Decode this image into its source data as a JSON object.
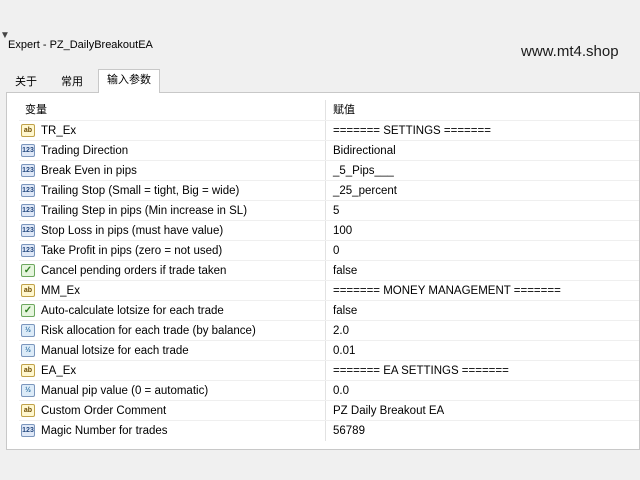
{
  "window": {
    "title": "Expert - PZ_DailyBreakoutEA",
    "watermark": "www.mt4.shop"
  },
  "tabs": [
    {
      "label": "关于",
      "active": false
    },
    {
      "label": "常用",
      "active": false
    },
    {
      "label": "输入参数",
      "active": true
    }
  ],
  "grid": {
    "headers": {
      "variable": "变量",
      "value": "赋值"
    },
    "rows": [
      {
        "icon": "ab",
        "type": "str",
        "name": "TR_Ex",
        "value": "======= SETTINGS ======="
      },
      {
        "icon": "123",
        "type": "int",
        "name": "Trading Direction",
        "value": "Bidirectional"
      },
      {
        "icon": "123",
        "type": "int",
        "name": "Break Even in pips",
        "value": "_5_Pips___"
      },
      {
        "icon": "123",
        "type": "int",
        "name": "Trailing Stop (Small = tight, Big = wide)",
        "value": "_25_percent"
      },
      {
        "icon": "123",
        "type": "int",
        "name": "Trailing Step in pips (Min increase in SL)",
        "value": "5"
      },
      {
        "icon": "123",
        "type": "int",
        "name": "Stop Loss in pips (must have value)",
        "value": "100"
      },
      {
        "icon": "123",
        "type": "int",
        "name": "Take Profit in pips (zero = not used)",
        "value": "0"
      },
      {
        "icon": "✓",
        "type": "bool",
        "name": "Cancel pending orders if trade taken",
        "value": "false"
      },
      {
        "icon": "ab",
        "type": "str",
        "name": "MM_Ex",
        "value": "======= MONEY MANAGEMENT ======="
      },
      {
        "icon": "✓",
        "type": "bool",
        "name": "Auto-calculate lotsize for each trade",
        "value": "false"
      },
      {
        "icon": "½",
        "type": "dbl",
        "name": "Risk allocation for each trade (by balance)",
        "value": "2.0"
      },
      {
        "icon": "½",
        "type": "dbl",
        "name": "Manual lotsize for each trade",
        "value": "0.01"
      },
      {
        "icon": "ab",
        "type": "str",
        "name": "EA_Ex",
        "value": "======= EA SETTINGS ======="
      },
      {
        "icon": "½",
        "type": "dbl",
        "name": "Manual pip value (0 = automatic)",
        "value": "0.0"
      },
      {
        "icon": "ab",
        "type": "str",
        "name": "Custom Order Comment",
        "value": "PZ Daily Breakout EA"
      },
      {
        "icon": "123",
        "type": "int",
        "name": "Magic Number for trades",
        "value": "56789"
      }
    ]
  }
}
